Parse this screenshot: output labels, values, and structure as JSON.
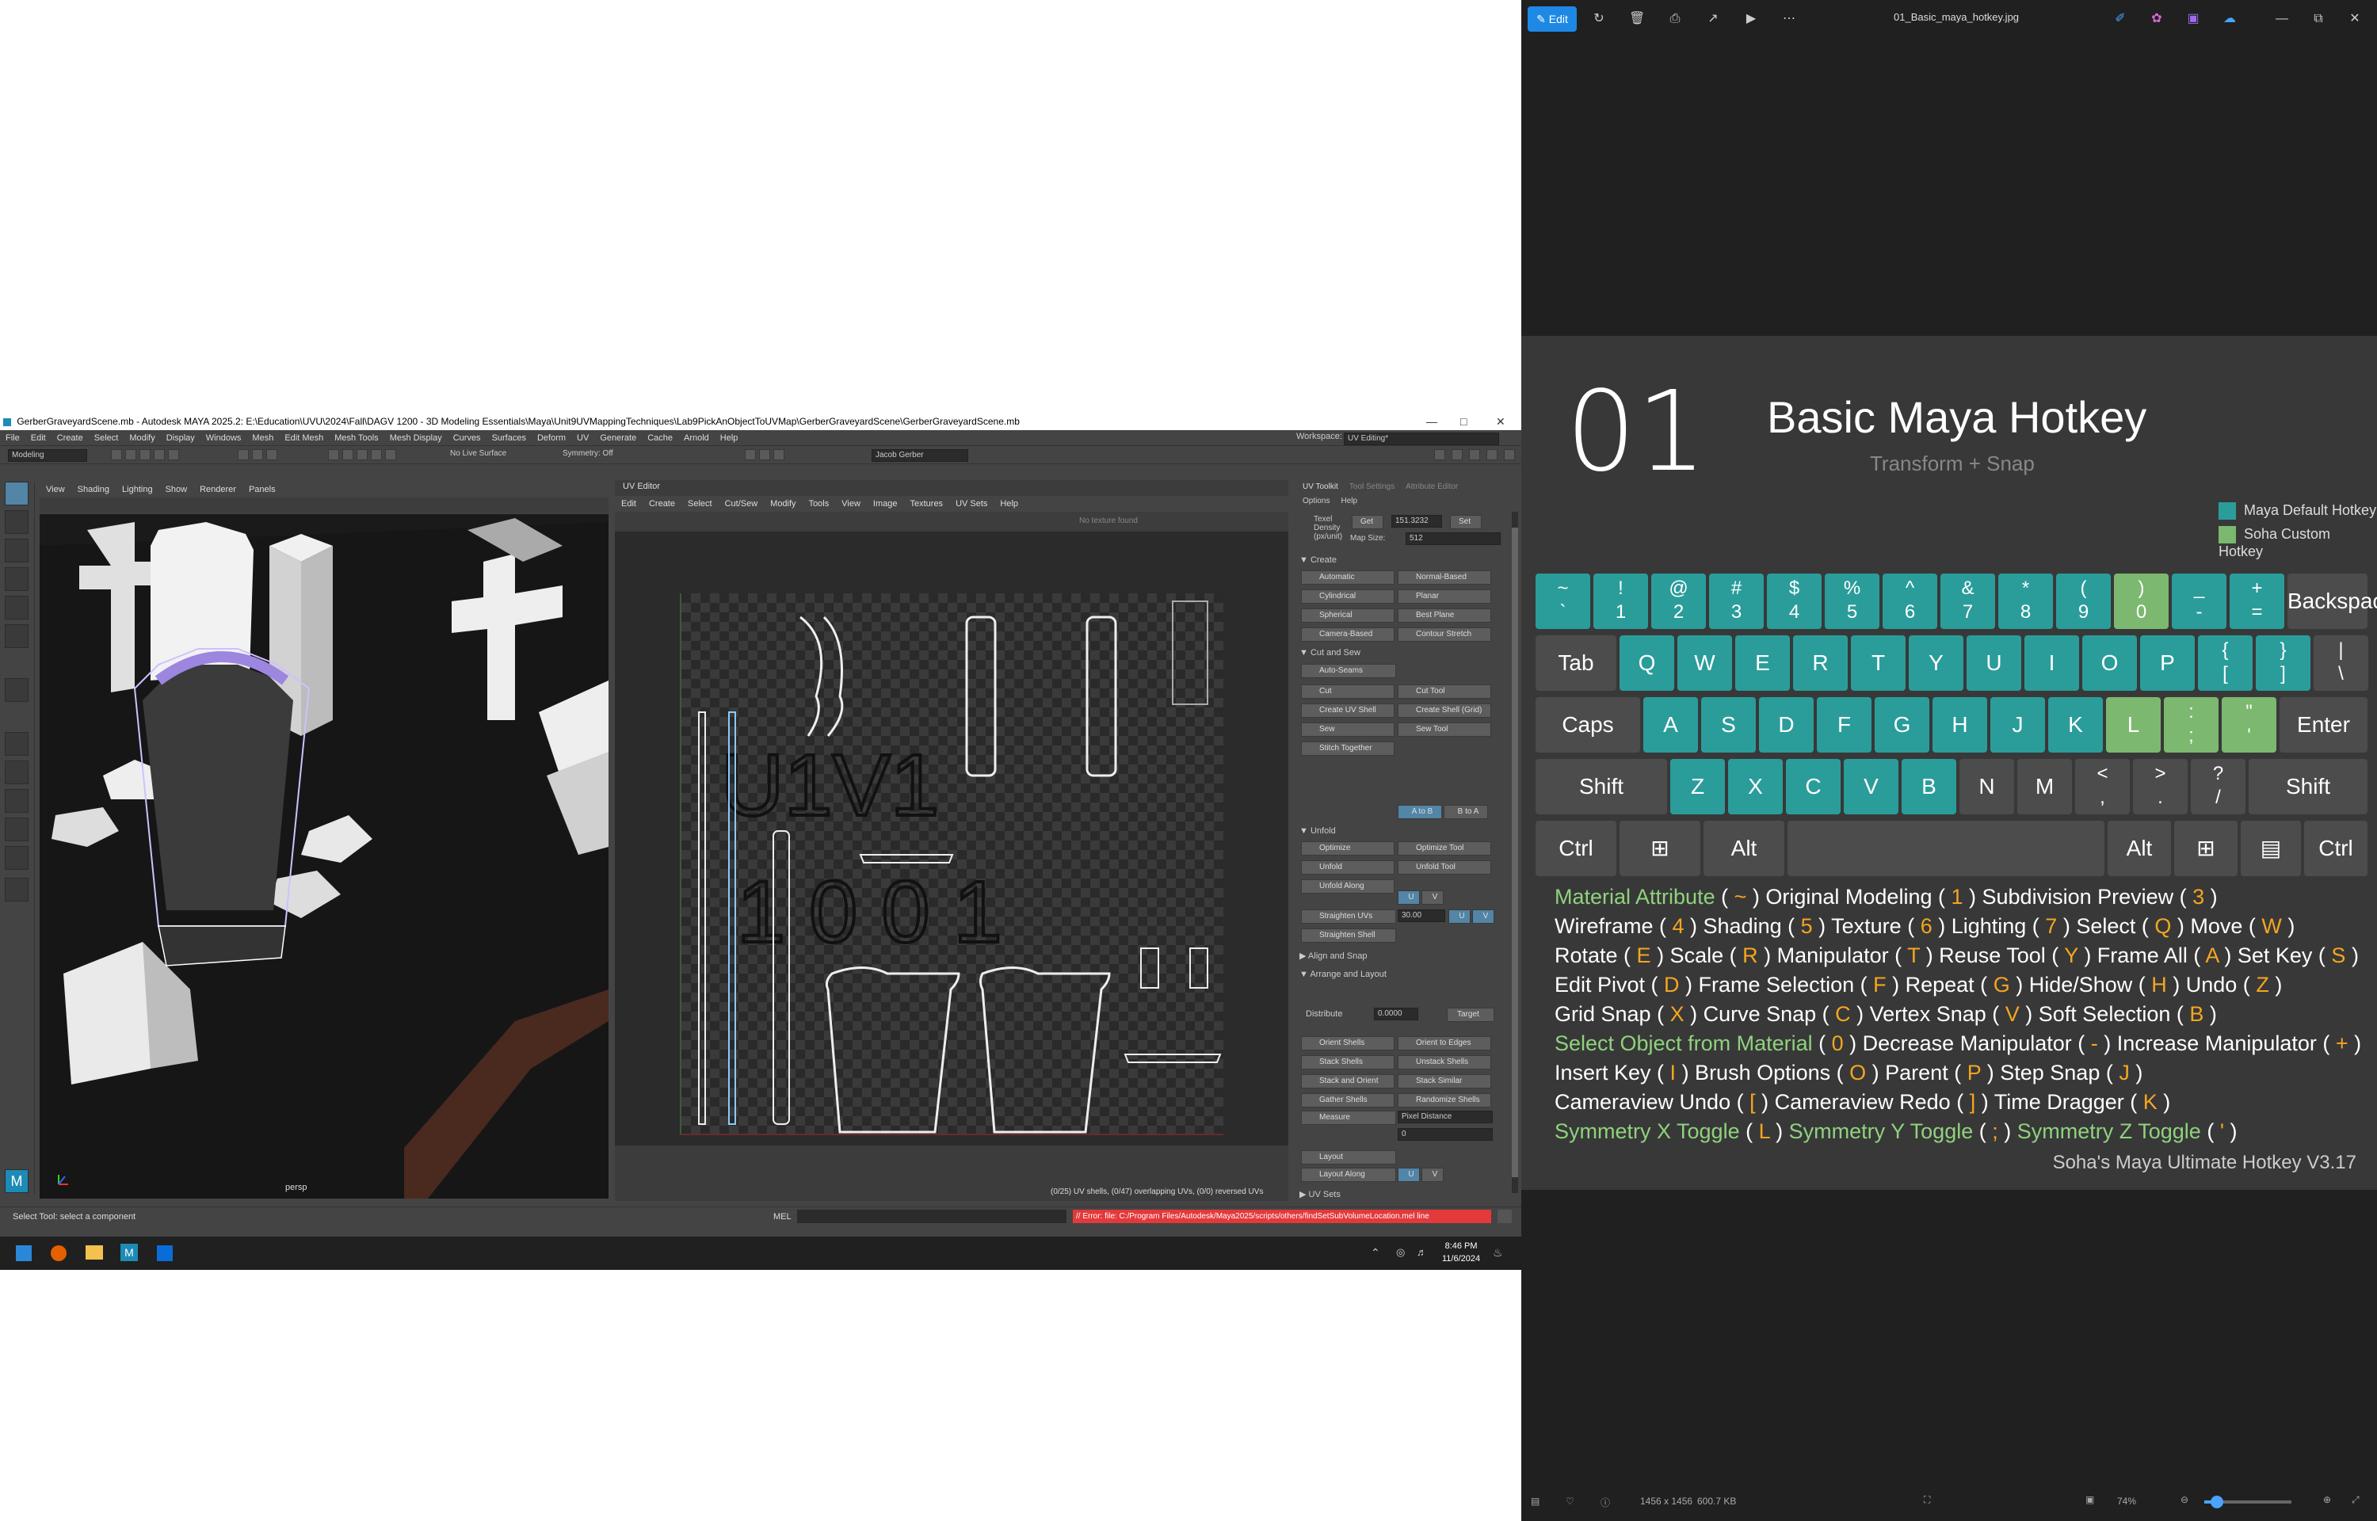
{
  "maya": {
    "title": "GerberGraveyardScene.mb - Autodesk MAYA 2025.2: E:\\Education\\UVU\\2024\\Fall\\DAGV 1200 - 3D Modeling Essentials\\Maya\\Unit9UVMappingTechniques\\Lab9PickAnObjectToUVMap\\GerberGraveyardScene\\GerberGraveyardScene.mb",
    "menus": [
      "File",
      "Edit",
      "Create",
      "Select",
      "Modify",
      "Display",
      "Windows",
      "Mesh",
      "Edit Mesh",
      "Mesh Tools",
      "Mesh Display",
      "Curves",
      "Surfaces",
      "Deform",
      "UV",
      "Generate",
      "Cache",
      "Arnold",
      "Help"
    ],
    "workspace_label": "Workspace:",
    "workspace_value": "UV Editing*",
    "mode_dropdown": "Modeling",
    "live_surface": "No Live Surface",
    "symmetry": "Symmetry: Off",
    "user": "Jacob Gerber",
    "viewport_menus": [
      "View",
      "Shading",
      "Lighting",
      "Show",
      "Renderer",
      "Panels"
    ],
    "viewport_label": "persp",
    "uv_editor_title": "UV Editor",
    "uv_editor_menus": [
      "Edit",
      "Create",
      "Select",
      "Cut/Sew",
      "Modify",
      "Tools",
      "View",
      "Image",
      "Textures",
      "UV Sets",
      "Help"
    ],
    "no_texture": "No texture found",
    "uv_tile_label": "U1V1",
    "uv_tile_number": "1001",
    "uv_status": "(0/25) UV shells, (0/47) overlapping UVs, (0/0) reversed UVs",
    "toolkit": {
      "tabs": [
        "UV Toolkit",
        "Tool Settings",
        "Attribute Editor"
      ],
      "menus": [
        "Options",
        "Help"
      ],
      "texel_label": "Texel Density (px/unit)",
      "get": "Get",
      "texel_value": "151.3232",
      "set": "Set",
      "map_size_label": "Map Size:",
      "map_size": "512",
      "create_header": "Create",
      "create_items": [
        "Automatic",
        "Normal-Based",
        "Cylindrical",
        "Planar",
        "Spherical",
        "Best Plane",
        "Camera-Based",
        "Contour Stretch"
      ],
      "cutsew_header": "Cut and Sew",
      "auto_seams": "Auto-Seams",
      "cutsew_items": [
        "Cut",
        "Cut Tool",
        "Create UV Shell",
        "Create Shell (Grid)",
        "Sew",
        "Sew Tool",
        "Stitch Together"
      ],
      "a_to_b": "A to B",
      "b_to_a": "B to A",
      "unfold_header": "Unfold",
      "unfold_items": [
        "Optimize",
        "Optimize Tool",
        "Unfold",
        "Unfold Tool",
        "Unfold Along"
      ],
      "u": "U",
      "v": "V",
      "straighten_uvs": "Straighten UVs",
      "straighten_value": "30.00",
      "straighten_shell": "Straighten Shell",
      "align_header": "Align and Snap",
      "arrange_header": "Arrange and Layout",
      "distribute": "Distribute",
      "distribute_value": "0.0000",
      "target": "Target",
      "arrange_items": [
        "Orient Shells",
        "Orient to Edges",
        "Stack Shells",
        "Unstack Shells",
        "Stack and Orient",
        "Stack Similar",
        "Gather Shells",
        "Randomize Shells"
      ],
      "measure": "Measure",
      "measure_value": "Pixel Distance",
      "measure_num": "0",
      "layout": "Layout",
      "layout_along": "Layout Along",
      "uvsets_header": "UV Sets"
    },
    "status_left": "Select Tool: select a component",
    "mel": "MEL",
    "error": "// Error: file: C:/Program Files/Autodesk/Maya2025/scripts/others/findSetSubVolumeLocation.mel line",
    "clock_time": "8:46 PM",
    "clock_date": "11/6/2024"
  },
  "viewer": {
    "edit": "Edit",
    "filename": "01_Basic_maya_hotkey.jpg",
    "number": "01",
    "title": "Basic Maya Hotkey",
    "subtitle": "Transform + Snap",
    "legend_default": "Maya Default Hotkey",
    "legend_custom": "Soha Custom Hotkey",
    "legend_default_color": "#2a9d9b",
    "legend_custom_color": "#7cb870",
    "hotkey_lines": [
      [
        {
          "t": "Material Attribute",
          "c": "g"
        },
        {
          "t": " ( "
        },
        {
          "t": "~",
          "c": "y"
        },
        {
          "t": " ) Original Modeling ( "
        },
        {
          "t": "1",
          "c": "y"
        },
        {
          "t": " ) Subdivision Preview ( "
        },
        {
          "t": "3",
          "c": "y"
        },
        {
          "t": " )"
        }
      ],
      [
        {
          "t": "Wireframe ( "
        },
        {
          "t": "4",
          "c": "y"
        },
        {
          "t": " ) Shading ( "
        },
        {
          "t": "5",
          "c": "y"
        },
        {
          "t": " ) Texture ( "
        },
        {
          "t": "6",
          "c": "y"
        },
        {
          "t": " ) Lighting ( "
        },
        {
          "t": "7",
          "c": "y"
        },
        {
          "t": " ) Select ( "
        },
        {
          "t": "Q",
          "c": "y"
        },
        {
          "t": " ) Move ( "
        },
        {
          "t": "W",
          "c": "y"
        },
        {
          "t": " )"
        }
      ],
      [
        {
          "t": "Rotate ( "
        },
        {
          "t": "E",
          "c": "y"
        },
        {
          "t": " ) Scale ( "
        },
        {
          "t": "R",
          "c": "y"
        },
        {
          "t": " ) Manipulator ( "
        },
        {
          "t": "T",
          "c": "y"
        },
        {
          "t": " ) Reuse Tool ( "
        },
        {
          "t": "Y",
          "c": "y"
        },
        {
          "t": " ) Frame All ( "
        },
        {
          "t": "A",
          "c": "y"
        },
        {
          "t": " ) Set Key ( "
        },
        {
          "t": "S",
          "c": "y"
        },
        {
          "t": " )"
        }
      ],
      [
        {
          "t": "Edit Pivot ( "
        },
        {
          "t": "D",
          "c": "y"
        },
        {
          "t": " ) Frame Selection ( "
        },
        {
          "t": "F",
          "c": "y"
        },
        {
          "t": " ) Repeat ( "
        },
        {
          "t": "G",
          "c": "y"
        },
        {
          "t": " ) Hide/Show ( "
        },
        {
          "t": "H",
          "c": "y"
        },
        {
          "t": " ) Undo ( "
        },
        {
          "t": "Z",
          "c": "y"
        },
        {
          "t": " )"
        }
      ],
      [
        {
          "t": "Grid Snap ( "
        },
        {
          "t": "X",
          "c": "y"
        },
        {
          "t": " ) Curve Snap ( "
        },
        {
          "t": "C",
          "c": "y"
        },
        {
          "t": " ) Vertex Snap ( "
        },
        {
          "t": "V",
          "c": "y"
        },
        {
          "t": " ) Soft Selection ( "
        },
        {
          "t": "B",
          "c": "y"
        },
        {
          "t": " )"
        }
      ],
      [
        {
          "t": "Select Object from Material",
          "c": "g"
        },
        {
          "t": " ( "
        },
        {
          "t": "0",
          "c": "y"
        },
        {
          "t": " ) Decrease Manipulator ( "
        },
        {
          "t": "-",
          "c": "y"
        },
        {
          "t": " ) Increase Manipulator ( "
        },
        {
          "t": "+",
          "c": "y"
        },
        {
          "t": " )"
        }
      ],
      [
        {
          "t": "Insert Key ( "
        },
        {
          "t": "I",
          "c": "y"
        },
        {
          "t": " ) Brush Options ( "
        },
        {
          "t": "O",
          "c": "y"
        },
        {
          "t": " ) Parent ( "
        },
        {
          "t": "P",
          "c": "y"
        },
        {
          "t": " ) Step Snap ( "
        },
        {
          "t": "J",
          "c": "y"
        },
        {
          "t": " )"
        }
      ],
      [
        {
          "t": "Cameraview Undo ( "
        },
        {
          "t": "[",
          "c": "y"
        },
        {
          "t": " ) Cameraview Redo ( "
        },
        {
          "t": "]",
          "c": "y"
        },
        {
          "t": " ) Time Dragger ( "
        },
        {
          "t": "K",
          "c": "y"
        },
        {
          "t": " )"
        }
      ],
      [
        {
          "t": "Symmetry X Toggle",
          "c": "g"
        },
        {
          "t": " ( "
        },
        {
          "t": "L",
          "c": "y"
        },
        {
          "t": " ) "
        },
        {
          "t": "Symmetry Y Toggle",
          "c": "g"
        },
        {
          "t": " ( "
        },
        {
          "t": ";",
          "c": "y"
        },
        {
          "t": " ) "
        },
        {
          "t": "Symmetry Z Toggle",
          "c": "g"
        },
        {
          "t": " ( "
        },
        {
          "t": "'",
          "c": "y"
        },
        {
          "t": " )"
        }
      ]
    ],
    "credit": "Soha's Maya Ultimate Hotkey V3.17",
    "keyboard": {
      "row1": [
        [
          "~",
          "`",
          "t"
        ],
        [
          "!",
          "1",
          "t"
        ],
        [
          "@",
          "2",
          "t"
        ],
        [
          "#",
          "3",
          "t"
        ],
        [
          "$",
          "4",
          "t"
        ],
        [
          "%",
          "5",
          "t"
        ],
        [
          "^",
          "6",
          "t"
        ],
        [
          "&",
          "7",
          "t"
        ],
        [
          "*",
          "8",
          "t"
        ],
        [
          "(",
          "9",
          "t"
        ],
        [
          ")",
          "0",
          "g"
        ],
        [
          "_",
          "-",
          "t"
        ],
        [
          "+",
          "=",
          "t"
        ]
      ],
      "backspace": "Backspace",
      "row2": [
        [
          "Q",
          "t"
        ],
        [
          "W",
          "t"
        ],
        [
          "E",
          "t"
        ],
        [
          "R",
          "t"
        ],
        [
          "T",
          "t"
        ],
        [
          "Y",
          "t"
        ],
        [
          "U",
          "t"
        ],
        [
          "I",
          "t"
        ],
        [
          "O",
          "t"
        ],
        [
          "P",
          "t"
        ]
      ],
      "row2_brackets": [
        [
          "{",
          "["
        ],
        [
          "}",
          "]"
        ],
        [
          "|",
          "\\"
        ]
      ],
      "tab": "Tab",
      "row3": [
        [
          "A",
          "t"
        ],
        [
          "S",
          "t"
        ],
        [
          "D",
          "t"
        ],
        [
          "F",
          "t"
        ],
        [
          "G",
          "t"
        ],
        [
          "H",
          "t"
        ],
        [
          "J",
          "t"
        ],
        [
          "K",
          "t"
        ],
        [
          "L",
          "g"
        ]
      ],
      "row3_punct": [
        [
          ":",
          ";"
        ],
        [
          "\"",
          "'"
        ]
      ],
      "capslock": "Caps Lock",
      "enter": "Enter",
      "row4": [
        [
          "Z",
          "t"
        ],
        [
          "X",
          "t"
        ],
        [
          "C",
          "t"
        ],
        [
          "V",
          "t"
        ],
        [
          "B",
          "t"
        ],
        [
          "N",
          ""
        ],
        [
          "M",
          ""
        ]
      ],
      "row4_punct": [
        [
          "<",
          ","
        ],
        [
          ">",
          "."
        ],
        [
          "?",
          "/"
        ]
      ],
      "shift": "Shift",
      "ctrl": "Ctrl",
      "alt": "Alt"
    },
    "image_dims": "1456 x 1456",
    "file_size": "600.7 KB",
    "zoom": "74%"
  }
}
